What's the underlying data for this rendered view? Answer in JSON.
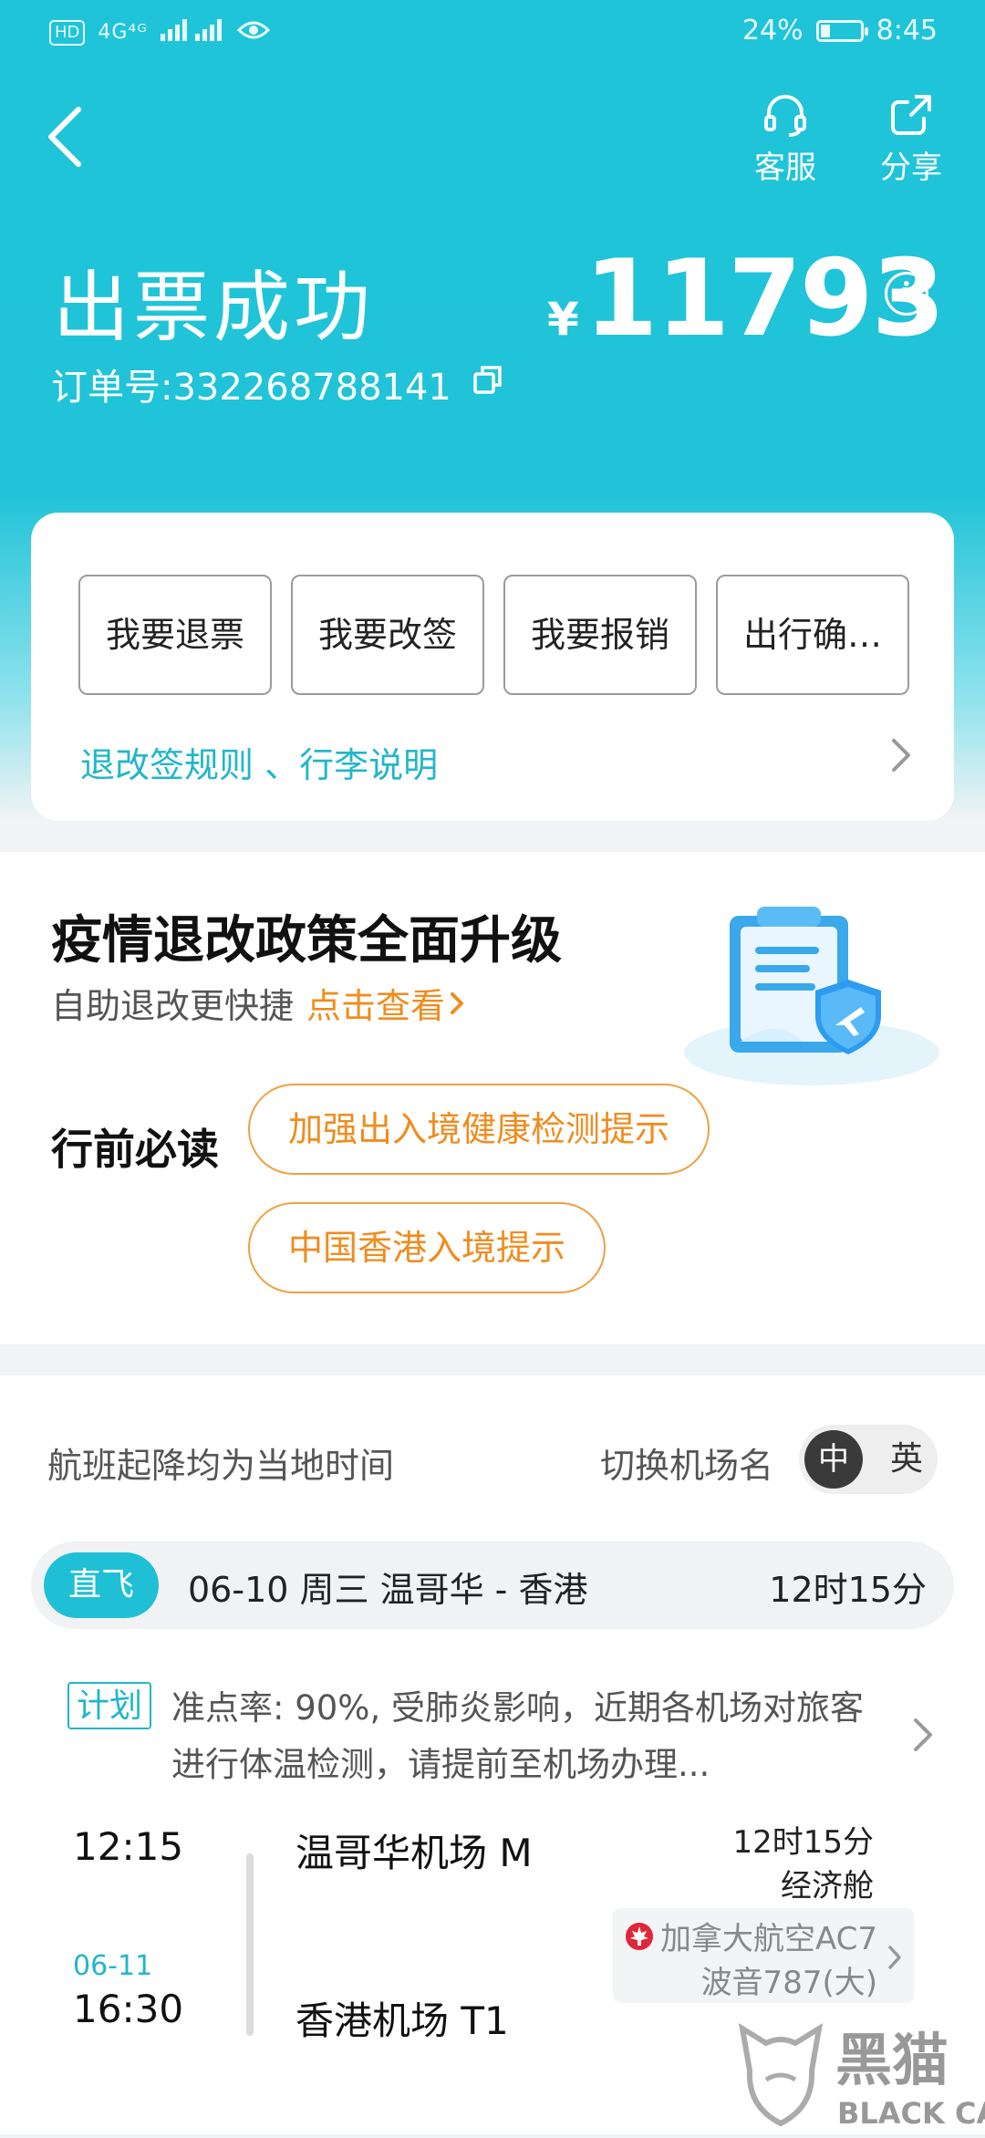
{
  "status_bar": {
    "hd": "HD",
    "network": "4G⁴ᴳ",
    "battery": "24%",
    "battery_level": 0.24,
    "time": "8:45"
  },
  "header": {
    "service_label": "客服",
    "share_label": "分享",
    "title": "出票成功",
    "currency": "¥",
    "price": "11793",
    "order_label": "订单号:332268788141"
  },
  "actions": {
    "buttons": [
      "我要退票",
      "我要改签",
      "我要报销",
      "出行确…"
    ],
    "rules_link": "退改签规则 、行李说明"
  },
  "promo": {
    "title": "疫情退改政策全面升级",
    "subtitle": "自助退改更快捷",
    "link": "点击查看",
    "must_read": "行前必读",
    "tips": [
      "加强出入境健康检测提示",
      "中国香港入境提示"
    ]
  },
  "flight": {
    "local_time_note": "航班起降均为当地时间",
    "switch_label": "切换机场名",
    "lang_active": "中",
    "lang_inactive": "英",
    "direct_tag": "直飞",
    "route": "06-10  周三  温哥华 - 香港",
    "duration": "12时15分",
    "plan_tag": "计划",
    "plan_text": "准点率: 90%, 受肺炎影响，近期各机场对旅客进行体温检测，请提前至机场办理...",
    "dep_time": "12:15",
    "arr_date": "06-11",
    "arr_time": "16:30",
    "dep_airport": "温哥华机场 M",
    "arr_airport": "香港机场 T1",
    "duration_small": "12时15分",
    "cabin": "经济舱",
    "airline": "加拿大航空AC7",
    "aircraft": "波音787(大)"
  },
  "watermark": {
    "brand_cn": "黑猫",
    "brand_en": "BLACK CAT"
  },
  "colors": {
    "accent": "#1fc4d9",
    "orange": "#f08c1e",
    "link": "#22b6c9"
  }
}
